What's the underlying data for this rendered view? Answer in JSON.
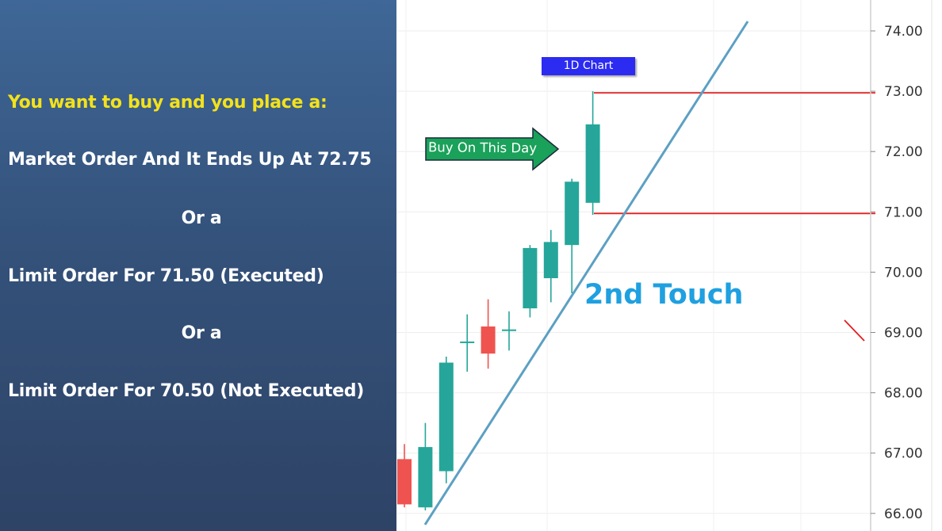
{
  "left_panel": {
    "line1": "You want to buy and you place a:",
    "line2": "Market Order And It Ends Up At 72.75",
    "line3": "Or a",
    "line4": "Limit Order For 71.50 (Executed)",
    "line5": "Or a",
    "line6": "Limit Order For 70.50 (Not Executed)",
    "colors": {
      "background": "#365a86",
      "highlight": "#f4e21a",
      "text": "#ffffff"
    }
  },
  "chart_data": {
    "type": "candlestick",
    "title": "",
    "xlabel": "",
    "ylabel": "",
    "ylim": [
      65.85,
      74.3
    ],
    "y_ticks": [
      "66.00",
      "67.00",
      "68.00",
      "69.00",
      "70.00",
      "71.00",
      "72.00",
      "73.00",
      "74.00"
    ],
    "grid": true,
    "candles": [
      {
        "open": 66.9,
        "high": 67.15,
        "low": 66.1,
        "close": 66.15
      },
      {
        "open": 66.1,
        "high": 67.5,
        "low": 66.05,
        "close": 67.1
      },
      {
        "open": 66.7,
        "high": 68.6,
        "low": 66.5,
        "close": 68.5
      },
      {
        "open": 68.85,
        "high": 69.3,
        "low": 68.35,
        "close": 68.85
      },
      {
        "open": 69.1,
        "high": 69.55,
        "low": 68.4,
        "close": 68.65
      },
      {
        "open": 69.05,
        "high": 69.35,
        "low": 68.7,
        "close": 69.05
      },
      {
        "open": 69.4,
        "high": 70.45,
        "low": 69.25,
        "close": 70.4
      },
      {
        "open": 69.9,
        "high": 70.7,
        "low": 69.5,
        "close": 70.5
      },
      {
        "open": 70.45,
        "high": 71.55,
        "low": 69.65,
        "close": 71.5
      },
      {
        "open": 71.15,
        "high": 73.0,
        "low": 70.95,
        "close": 72.45
      }
    ],
    "annotations": {
      "chart_tag": "1D Chart",
      "arrow_label": "Buy On This Day",
      "trendline_label": "2nd Touch",
      "levels": [
        73.0,
        71.0
      ]
    },
    "colors": {
      "up": "#26a69a",
      "down": "#ef5350",
      "trendline": "#5ca0c3",
      "level_line": "#e02020",
      "arrow": "#1aa15a",
      "tag": "#2b2bf2",
      "trendline_label": "#1fa0e0"
    }
  }
}
